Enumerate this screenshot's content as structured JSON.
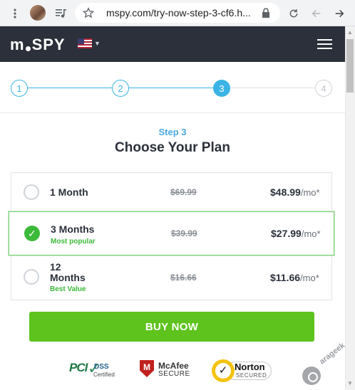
{
  "browser": {
    "url": "mspy.com/try-now-step-3-cf6.h...",
    "icons": [
      "more-vert-icon",
      "avatar",
      "media-control-icon",
      "star-icon",
      "lock-icon",
      "reload-icon",
      "back-icon",
      "forward-icon"
    ]
  },
  "header": {
    "logo_prefix": "m",
    "logo_suffix": "SPY",
    "language_flag": "US flag",
    "menu_icon": "hamburger-icon"
  },
  "stepper": {
    "steps": [
      "1",
      "2",
      "3",
      "4"
    ],
    "active_step": 3
  },
  "content": {
    "step_label": "Step 3",
    "title": "Choose Your Plan"
  },
  "plans": [
    {
      "name_line1": "1 Month",
      "name_line2": "",
      "note": "",
      "old_price": "$69.99",
      "price": "$48.99",
      "unit": "/mo*",
      "selected": false
    },
    {
      "name_line1": "3 Months",
      "name_line2": "",
      "note": "Most popular",
      "old_price": "$39.99",
      "price": "$27.99",
      "unit": "/mo*",
      "selected": true
    },
    {
      "name_line1": "12",
      "name_line2": "Months",
      "note": "Best Value",
      "old_price": "$16.66",
      "price": "$11.66",
      "unit": "/mo*",
      "selected": false
    }
  ],
  "buy_button": "BUY NOW",
  "badges": {
    "pci": {
      "main": "PCI",
      "dss": "DSS",
      "sub": "Certified"
    },
    "mcafee": {
      "letter": "M",
      "brand": "McAfee",
      "sub": "SECURE"
    },
    "norton": {
      "brand": "Norton",
      "sub": "SECURED"
    }
  },
  "watermark": "arageek",
  "colors": {
    "header_bg": "#2b303a",
    "stepper_accent": "#3bb4e5",
    "selected_border": "#7dd07a",
    "check_green": "#3cba3a",
    "buy_green": "#5ec31d"
  }
}
